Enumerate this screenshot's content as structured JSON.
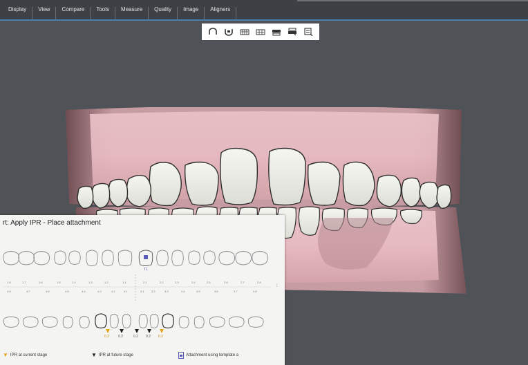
{
  "menu": {
    "items": [
      "Display",
      "View",
      "Compare",
      "Tools",
      "Measure",
      "Quality",
      "Image",
      "Aligners"
    ]
  },
  "toolbar": {
    "icons": [
      "front-view-icon",
      "bottom-view-icon",
      "left-view-icon",
      "right-view-icon",
      "upper-jaw-icon",
      "lower-jaw-icon",
      "occlusion-icon"
    ]
  },
  "panel": {
    "title": "rt: Apply IPR - Place attachment",
    "upper_numbers": [
      "1.8",
      "1.7",
      "1.6",
      "1.5",
      "1.4",
      "1.3",
      "1.2",
      "1.1",
      "2.1",
      "2.2",
      "2.3",
      "2.4",
      "2.5",
      "2.6",
      "2.7",
      "2.8"
    ],
    "lower_numbers": [
      "4.8",
      "4.7",
      "4.6",
      "4.5",
      "4.4",
      "4.3",
      "4.2",
      "4.1",
      "3.1",
      "3.2",
      "3.3",
      "3.4",
      "3.5",
      "3.6",
      "3.7",
      "3.8"
    ],
    "attachment_label": "T1",
    "ipr_labels": [
      "0.2",
      "0.2",
      "0.2",
      "0.2",
      "0.2"
    ],
    "legend": {
      "current": "IPR at current stage",
      "future": "IPR at future stage",
      "attachment": "Attachment using template a"
    }
  },
  "colors": {
    "accent": "#4a7fb0",
    "ipr_current": "#e2a21a",
    "attachment": "#5a5ab8",
    "gum": "#e3b8bd"
  }
}
